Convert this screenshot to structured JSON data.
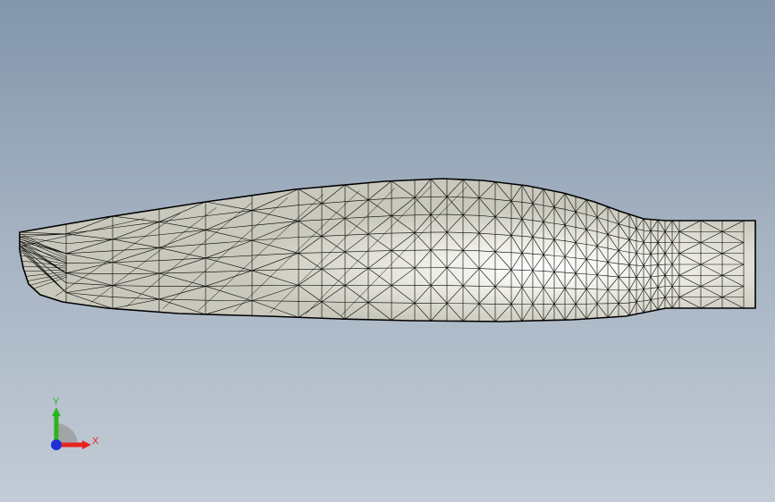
{
  "viewport": {
    "background_top": "#8396ab",
    "background_bottom": "#c3ccd6"
  },
  "model": {
    "name": "propeller-blade-mesh",
    "face_color": "#d9d8cc",
    "highlight_color": "#ffffff",
    "edge_color": "#000000"
  },
  "triad": {
    "x_label": "X",
    "y_label": "Y",
    "x_color": "#e8231e",
    "y_color": "#2ab51d",
    "z_color": "#1d2fd6"
  }
}
